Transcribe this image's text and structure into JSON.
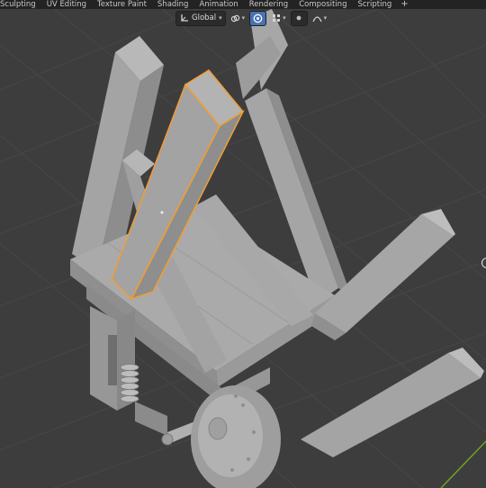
{
  "workspace_tabs": [
    {
      "label": "Sculpting"
    },
    {
      "label": "UV Editing"
    },
    {
      "label": "Texture Paint"
    },
    {
      "label": "Shading"
    },
    {
      "label": "Animation"
    },
    {
      "label": "Rendering"
    },
    {
      "label": "Compositing"
    },
    {
      "label": "Scripting"
    }
  ],
  "add_workspace_label": "+",
  "viewport_header": {
    "transform_orientation": "Global",
    "snap_icon": "magnet-link-icon",
    "proportional_icon": "proportional-edit-icon",
    "pivot_icon": "pivot-point-icon",
    "falloff_icon": "falloff-curve-icon"
  },
  "colors": {
    "viewport_bg": "#3d3d3d",
    "grid_line": "#474747",
    "mesh_face": "#a2a2a2",
    "mesh_face_dark": "#8c8c8c",
    "mesh_face_light": "#b5b5b5",
    "selection_outline": "#f29d32",
    "active_button": "#4772b3",
    "topbar_bg": "#232323",
    "axis_green": "#6fa025"
  }
}
